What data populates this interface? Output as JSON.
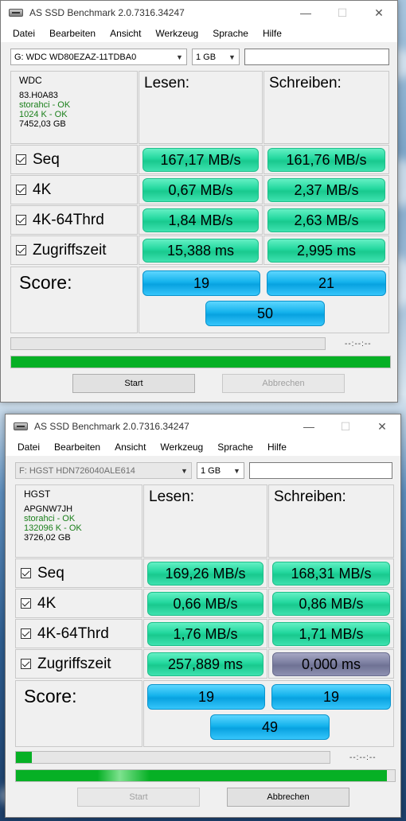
{
  "menu": [
    "Datei",
    "Bearbeiten",
    "Ansicht",
    "Werkzeug",
    "Sprache",
    "Hilfe"
  ],
  "windows": [
    {
      "title": "AS SSD Benchmark 2.0.7316.34247",
      "drive": "G: WDC WD80EZAZ-11TDBA0",
      "size": "1 GB",
      "info": {
        "name": "WDC",
        "firmware": "83.H0A83",
        "driver": "storahci - OK",
        "alignment": "1024 K - OK",
        "capacity": "7452,03 GB"
      },
      "headers": {
        "read": "Lesen:",
        "write": "Schreiben:"
      },
      "rows": [
        {
          "label": "Seq",
          "read": "167,17 MB/s",
          "write": "161,76 MB/s"
        },
        {
          "label": "4K",
          "read": "0,67 MB/s",
          "write": "2,37 MB/s"
        },
        {
          "label": "4K-64Thrd",
          "read": "1,84 MB/s",
          "write": "2,63 MB/s"
        },
        {
          "label": "Zugriffszeit",
          "read": "15,388 ms",
          "write": "2,995 ms"
        }
      ],
      "score": {
        "label": "Score:",
        "read": "19",
        "write": "21",
        "total": "50"
      },
      "timer": "--:--:--",
      "progress_top": 0,
      "progress_bottom": 1.0,
      "buttons": {
        "start": "Start",
        "abort": "Abbrechen"
      }
    },
    {
      "title": "AS SSD Benchmark 2.0.7316.34247",
      "drive": "F: HGST HDN726040ALE614",
      "size": "1 GB",
      "info": {
        "name": "HGST",
        "firmware": "APGNW7JH",
        "driver": "storahci - OK",
        "alignment": "132096 K - OK",
        "capacity": "3726,02 GB"
      },
      "headers": {
        "read": "Lesen:",
        "write": "Schreiben:"
      },
      "rows": [
        {
          "label": "Seq",
          "read": "169,26 MB/s",
          "write": "168,31 MB/s"
        },
        {
          "label": "4K",
          "read": "0,66 MB/s",
          "write": "0,86 MB/s"
        },
        {
          "label": "4K-64Thrd",
          "read": "1,76 MB/s",
          "write": "1,71 MB/s"
        },
        {
          "label": "Zugriffszeit",
          "read": "257,889 ms",
          "write": "0,000 ms"
        }
      ],
      "score": {
        "label": "Score:",
        "read": "19",
        "write": "19",
        "total": "49"
      },
      "timer": "--:--:--",
      "progress_top": 0.05,
      "progress_bottom": 0.98,
      "buttons": {
        "start": "Start",
        "abort": "Abbrechen"
      }
    }
  ],
  "colors": {
    "result_green": "#21d79d",
    "score_blue": "#14b2ec",
    "progress_green": "#06b025",
    "zero_gray": "#7b7ea0"
  }
}
